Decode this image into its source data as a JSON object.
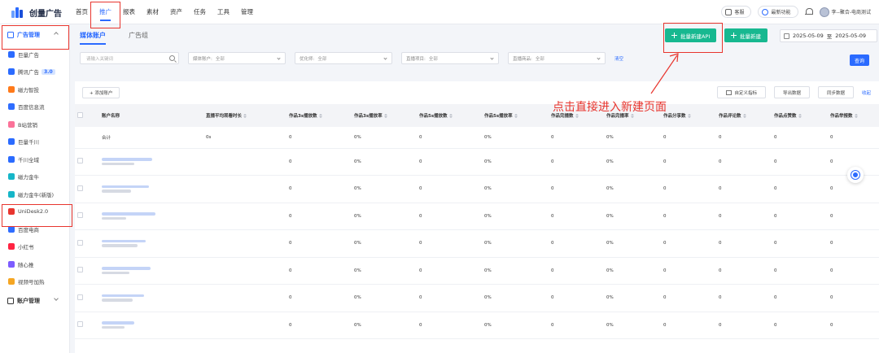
{
  "app": {
    "logo_text": "创量广告"
  },
  "nav": [
    "首页",
    "推广",
    "报表",
    "素材",
    "资产",
    "任务",
    "工具",
    "管理"
  ],
  "topbar": {
    "pill1": "客服",
    "pill2": "最新功能",
    "user": "李--聚合-电商测试"
  },
  "sidebar": {
    "group": "广告管理",
    "items": [
      {
        "label": "巨量广告",
        "color": "#2b6bff"
      },
      {
        "label": "腾讯广告",
        "badge": "3.0",
        "color": "#2b6bff"
      },
      {
        "label": "磁力智投",
        "color": "#ff7a1a"
      },
      {
        "label": "百度信息流",
        "color": "#2f6dff"
      },
      {
        "label": "B站营销",
        "color": "#fb7299"
      },
      {
        "label": "巨量千川",
        "color": "#2b6bff"
      },
      {
        "label": "千川全域",
        "color": "#2b6bff"
      },
      {
        "label": "磁力金牛",
        "color": "#16b6c8"
      },
      {
        "label": "磁力金牛(新版)",
        "color": "#16b6c8"
      },
      {
        "label": "UniDesk2.0",
        "color": "#e8352e"
      },
      {
        "label": "百度电商",
        "color": "#2f6dff"
      },
      {
        "label": "小红书",
        "color": "#ff2442"
      },
      {
        "label": "随心推",
        "color": "#7c5cff"
      },
      {
        "label": "视频号加热",
        "color": "#f5a623"
      }
    ],
    "bottom_group": "账户管理"
  },
  "main": {
    "tabs": [
      "媒体账户",
      "广告组"
    ],
    "batch_api_btn": "批量新建API",
    "batch_btn": "批量新建",
    "date_start": "2025-05-09",
    "date_to": "至",
    "date_end": "2025-05-09",
    "search_placeholder": "请输入关键词",
    "filters": [
      {
        "label": "媒体账户:",
        "value": "全部"
      },
      {
        "label": "优化师:",
        "value": "全部"
      },
      {
        "label": "直播项目:",
        "value": "全部"
      },
      {
        "label": "直播商品:",
        "value": "全部"
      }
    ],
    "clear": "清空",
    "search_btn": "查询",
    "add_account": "+ 添加账户",
    "actions": [
      "自定义指标",
      "导出数据",
      "同步数据"
    ],
    "collapse": "收起",
    "annotation": "点击直接进入新建页面"
  },
  "table": {
    "columns": [
      "账户名称",
      "直播平均观看时长",
      "作品3s播放数",
      "作品3s播放率",
      "作品5s播放数",
      "作品5s播放率",
      "作品完播数",
      "作品完播率",
      "作品分享数",
      "作品评论数",
      "作品点赞数",
      "作品举报数"
    ],
    "summary": [
      "合计",
      "0s",
      "0",
      "0%",
      "0",
      "0%",
      "0",
      "0%",
      "0",
      "0",
      "0",
      "0"
    ],
    "row_values": [
      "0",
      "0%",
      "0",
      "0%",
      "0",
      "0%",
      "0",
      "0",
      "0",
      "0"
    ],
    "row_count": 7
  }
}
